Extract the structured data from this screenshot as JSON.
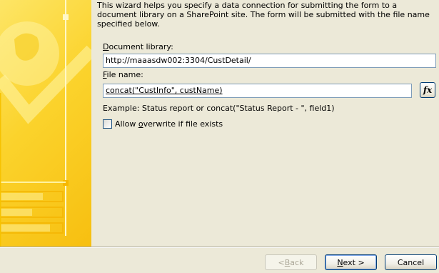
{
  "intro_text": "This wizard helps you specify a data connection for submitting the form to a document library on a SharePoint site. The form will be submitted with the file name specified below.",
  "document_library": {
    "label_accel": "D",
    "label_rest": "ocument library:",
    "value": "http://maaasdw002:3304/CustDetail/"
  },
  "file_name": {
    "label_accel": "F",
    "label_rest": "ile name:",
    "value": "concat(\"CustInfo\", custName)",
    "fx_label": "fx"
  },
  "example_text": "Example: Status report or concat(\"Status Report - \", field1)",
  "allow_overwrite": {
    "label_pre": "Allow ",
    "label_accel": "o",
    "label_rest": "verwrite if file exists",
    "checked": false
  },
  "buttons": {
    "back_pre": "< ",
    "back_accel": "B",
    "back_rest": "ack",
    "next_accel": "N",
    "next_rest": "ext >",
    "cancel": "Cancel"
  },
  "colors": {
    "art_yellow": "#fbd32c",
    "dialog_bg": "#ece9d8",
    "input_border": "#7f9db9",
    "button_border": "#003c74"
  }
}
